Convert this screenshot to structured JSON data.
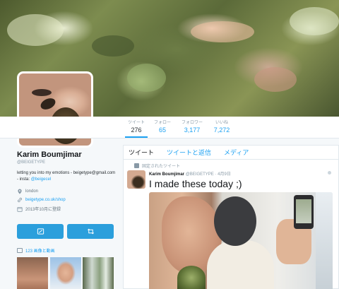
{
  "profile": {
    "name": "Karim Boumjimar",
    "handle": "@BEIGETYPE",
    "bio_text": "letting you into my emotions - beigetype@gmail.com - insta: ",
    "bio_link": "@beigecel",
    "location": "london",
    "website": "beigetype.co.uk/shop",
    "joined": "2013年10月に登録"
  },
  "stats": [
    {
      "label": "ツイート",
      "value": "276"
    },
    {
      "label": "フォロー",
      "value": "65"
    },
    {
      "label": "フォロワー",
      "value": "3,177"
    },
    {
      "label": "いいね",
      "value": "7,272"
    }
  ],
  "media": {
    "label": "123 画像と動画"
  },
  "tabs": [
    "ツイート",
    "ツイートと返信",
    "メディア"
  ],
  "pinned_label": "固定されたツイート",
  "tweet": {
    "author": "Karim Boumjimar",
    "handle": "@BEIGETYPE",
    "date": "4月9日",
    "text": "I made these today ;)"
  },
  "colors": {
    "accent": "#1da1f2",
    "button": "#2b9fdc",
    "background": "#f5f8fa"
  },
  "icons": {
    "location": "location-pin-icon",
    "website": "link-icon",
    "joined": "calendar-icon",
    "media": "photo-icon",
    "message": "message-icon",
    "retweet": "retweet-icon"
  }
}
